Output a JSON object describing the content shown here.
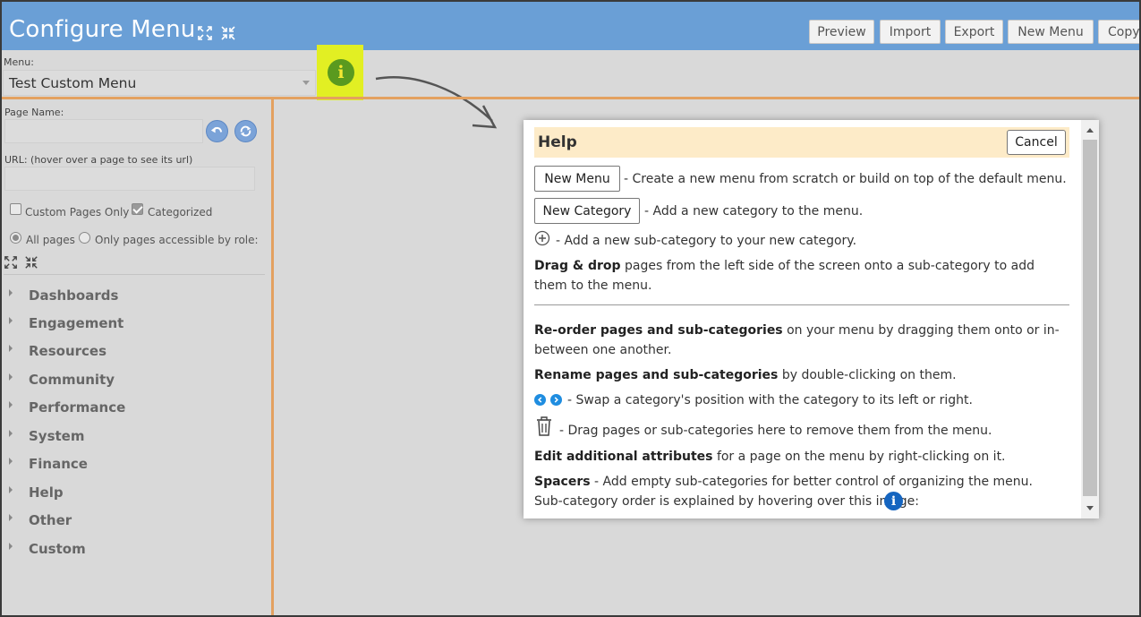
{
  "header": {
    "title": "Configure Menu",
    "buttons": [
      "Preview",
      "Import",
      "Export",
      "New Menu",
      "Copy"
    ]
  },
  "menu_selector": {
    "label": "Menu:",
    "value": "Test Custom Menu"
  },
  "sidebar": {
    "page_name_label": "Page Name:",
    "url_label": "URL: (hover over a page to see its url)",
    "custom_pages_only": "Custom Pages Only",
    "categorized": "Categorized",
    "all_pages": "All pages",
    "only_role": "Only pages accessible by role:",
    "categories": [
      "Dashboards",
      "Engagement",
      "Resources",
      "Community",
      "Performance",
      "System",
      "Finance",
      "Help",
      "Other",
      "Custom"
    ]
  },
  "help": {
    "title": "Help",
    "cancel": "Cancel",
    "new_menu_btn": "New Menu",
    "new_menu_desc": "- Create a new menu from scratch or build on top of the default menu.",
    "new_category_btn": "New Category",
    "new_category_desc": "- Add a new category to the menu.",
    "subcat_desc": "- Add a new sub-category to your new category.",
    "drag_bold": "Drag & drop",
    "drag_rest": "pages from the left side of the screen onto a sub-category to add them to the menu.",
    "reorder_bold": "Re-order pages and sub-categories",
    "reorder_rest": "on your menu by dragging them onto or in-between one another.",
    "rename_bold": "Rename pages and sub-categories",
    "rename_rest": "by double-clicking on them.",
    "swap_desc": "- Swap a category's position with the category to its left or right.",
    "trash_desc": "- Drag pages or sub-categories here to remove them from the menu.",
    "edit_bold": "Edit additional attributes",
    "edit_rest": "for a page on the menu by right-clicking on it.",
    "spacers_bold": "Spacers",
    "spacers_rest": "- Add empty sub-categories for better control of organizing the menu. Sub-category order is explained by hovering over this image:"
  },
  "colors": {
    "header_bg": "#6a9fd6",
    "accent_orange": "#e3a160",
    "help_header_bg": "#fdebc8",
    "highlight_yellow": "#e2ef23"
  }
}
